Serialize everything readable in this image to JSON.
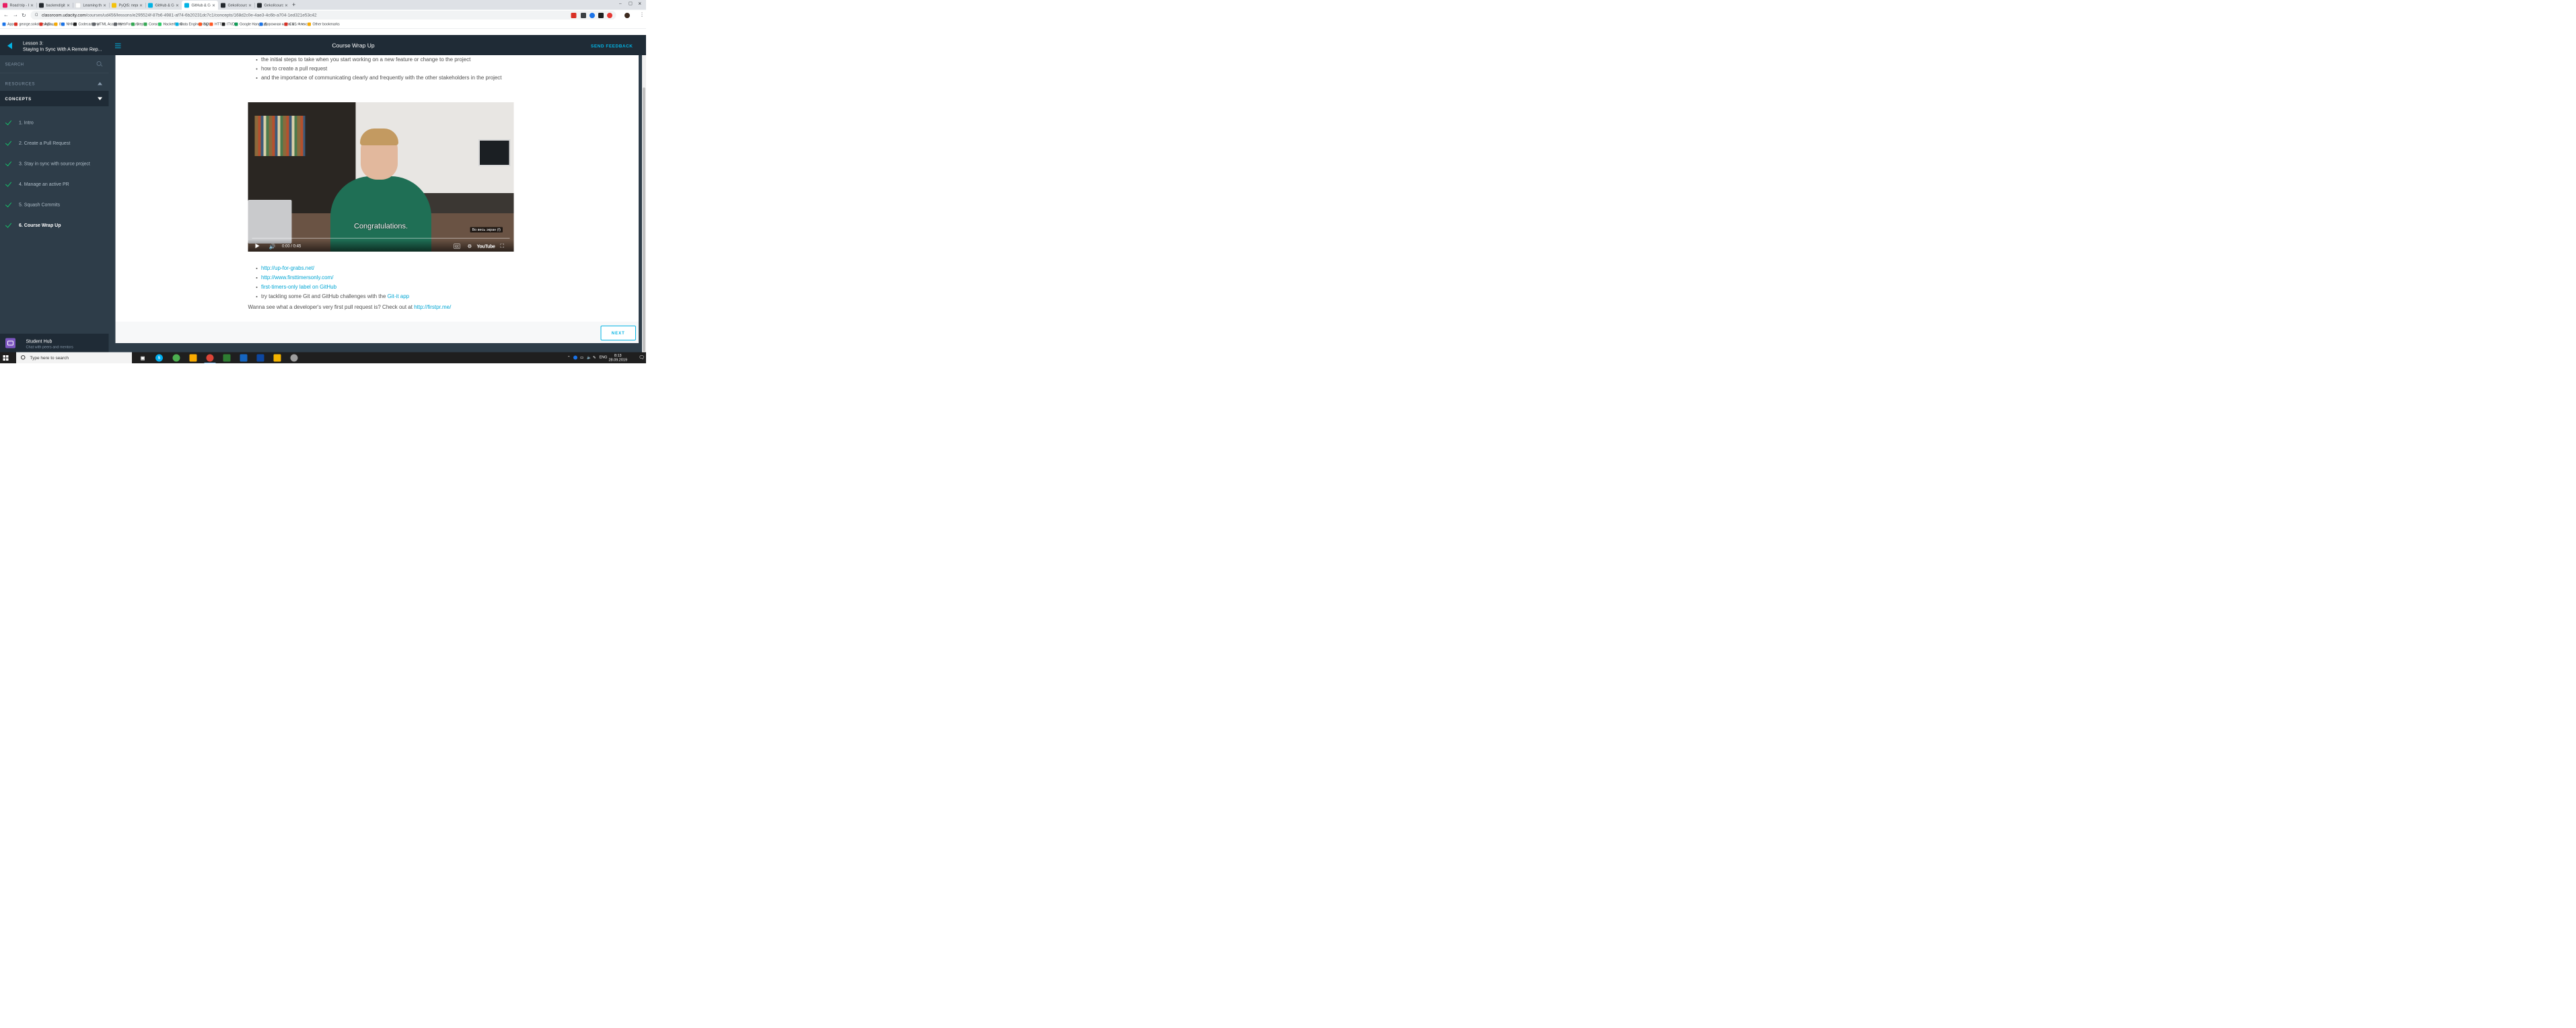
{
  "browser": {
    "tabs": [
      {
        "title": "Road trip - How DNS works",
        "favicon_color": "#e91e63",
        "favicon_char": "●"
      },
      {
        "title": "backend/git-collaboration",
        "favicon_color": "#24292e",
        "favicon_char": "◉"
      },
      {
        "title": "Learning the shell - Lesson",
        "favicon_color": "#ffffff",
        "favicon_char": ""
      },
      {
        "title": "PyQt5: первые программы",
        "favicon_color": "#f4c20d",
        "favicon_char": "●"
      },
      {
        "title": "GitHub & Collaboration - Udacity",
        "favicon_color": "#02b3e4",
        "favicon_char": "▼"
      },
      {
        "title": "GitHub & Collaboration - Udacity",
        "favicon_color": "#02b3e4",
        "favicon_char": "▼"
      },
      {
        "title": "Gekol/course-collaboration",
        "favicon_color": "#24292e",
        "favicon_char": "◉"
      },
      {
        "title": "Gekol/course-collaboration",
        "favicon_color": "#24292e",
        "favicon_char": "◉"
      }
    ],
    "new_tab_glyph": "+",
    "window_controls": [
      "–",
      "☐",
      "✕"
    ],
    "url_host": "classroom.udacity.com",
    "url_path": "/courses/ud456/lessons/e295524f-87b6-4981-af74-6b20231dc7c1/concepts/168d2c0e-4ae3-4c6b-a704-1ed321e53c42",
    "star_glyph": "☆",
    "bookmarks": [
      {
        "label": "Apps",
        "color": "#1a73e8"
      },
      {
        "label": "george.sokolovsky2...",
        "color": "#d93025"
      },
      {
        "label": "Афиша",
        "color": "#d93025"
      },
      {
        "label": "8",
        "color": "#f9ab00"
      },
      {
        "label": "NHM",
        "color": "#1a73e8"
      },
      {
        "label": "Codecademy",
        "color": "#1f1f1f"
      },
      {
        "label": "HTML Academy",
        "color": "#5f6368"
      },
      {
        "label": "WebForm.ru",
        "color": "#5f6368"
      },
      {
        "label": "Stepik",
        "color": "#34a853"
      },
      {
        "label": "Console",
        "color": "#34a853"
      },
      {
        "label": "HackerRank",
        "color": "#2ec866"
      },
      {
        "label": "Data Engineering",
        "color": "#02b3e4"
      },
      {
        "label": "SQL",
        "color": "#ff5722"
      },
      {
        "label": "HTTP",
        "color": "#ff5722"
      },
      {
        "label": "ITVDN",
        "color": "#1f1f1f"
      },
      {
        "label": "Google Hangouts",
        "color": "#0f9d58"
      },
      {
        "label": "Дорожная карта м...",
        "color": "#1a73e8"
      },
      {
        "label": "CSS Флекс",
        "color": "#d93025"
      },
      {
        "label": "»",
        "color": ""
      },
      {
        "label": "Other bookmarks",
        "color": "#f9ab00"
      }
    ]
  },
  "header": {
    "lesson_number": "Lesson 3:",
    "lesson_title": "Staying In Sync With A Remote Rep...",
    "page_title": "Course Wrap Up",
    "feedback_label": "SEND FEEDBACK"
  },
  "sidebar": {
    "search_label": "SEARCH",
    "resources_label": "RESOURCES",
    "concepts_label": "CONCEPTS",
    "concepts": [
      {
        "label": "1. Intro"
      },
      {
        "label": "2. Create a Pull Request"
      },
      {
        "label": "3. Stay in sync with source project"
      },
      {
        "label": "4. Manage an active PR"
      },
      {
        "label": "5. Squash Commits"
      },
      {
        "label": "6. Course Wrap Up"
      }
    ],
    "hub_title": "Student Hub",
    "hub_subtitle": "Chat with peers and mentors"
  },
  "content": {
    "bullets": [
      "the initial steps to take when you start working on a new feature or change to the project",
      "how to create a pull request",
      "and the importance of communicating clearly and frequently with the other stakeholders in the project"
    ],
    "video": {
      "caption": "Congratulations.",
      "fullscreen_tip": "Во весь экран (f)",
      "time": "0:00 / 0:45",
      "brand": "YouTube"
    },
    "links": [
      {
        "text": "http://up-for-grabs.net/"
      },
      {
        "text": "http://www.firsttimersonly.com/"
      },
      {
        "text": "first-timers-only label on GitHub"
      }
    ],
    "git_it_prefix": "try tackling some Git and GitHub challenges with the ",
    "git_it_link": "Git-it app",
    "firstpr_prefix": "Wanna see what a developer's very first pull request is? Check out at ",
    "firstpr_link": "http://firstpr.me/",
    "next_label": "NEXT"
  },
  "taskbar": {
    "search_placeholder": "Type here to search",
    "language": "ENG",
    "time": "8:13",
    "date": "28.09.2019"
  }
}
